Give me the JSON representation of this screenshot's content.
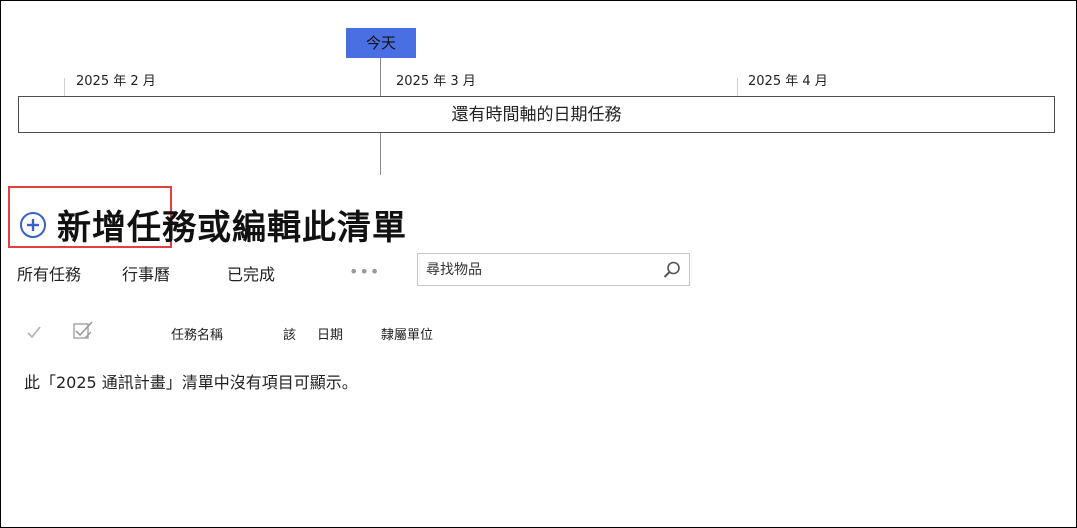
{
  "timeline": {
    "today_label": "今天",
    "months": [
      "2025 年 2 月",
      "2025 年 3 月",
      "2025 年 4 月"
    ],
    "bar_text": "還有時間軸的日期任務"
  },
  "header": {
    "add_icon": "plus-circle-icon",
    "title": "新增任務或編輯此清單"
  },
  "views": {
    "tabs": [
      "所有任務",
      "行事曆",
      "已完成"
    ],
    "more": "•••"
  },
  "search": {
    "placeholder": "尋找物品",
    "icon": "search-icon"
  },
  "columns": {
    "check_icon": "checkmark-icon",
    "type_icon": "edit-checkbox-icon",
    "task_name": "任務名稱",
    "due": "該",
    "date": "日期",
    "assigned": "隸屬單位"
  },
  "list": {
    "empty_message": "此「2025 通訊計畫」清單中沒有項目可顯示。"
  },
  "colors": {
    "today_badge": "#4a6fe3",
    "highlight": "#e04040",
    "add_icon": "#3a5fc8"
  }
}
